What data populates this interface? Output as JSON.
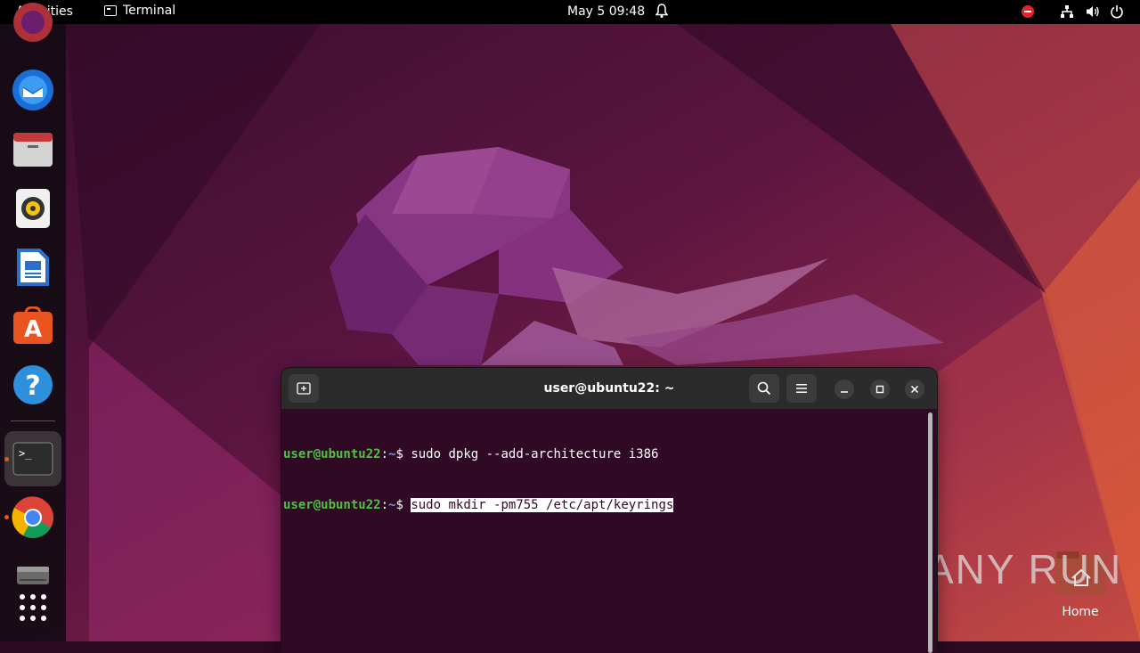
{
  "topbar": {
    "activities": "Activities",
    "app_name": "Terminal",
    "clock": "May 5  09:48"
  },
  "dock": {
    "items": [
      {
        "name": "firefox-icon"
      },
      {
        "name": "thunderbird-icon"
      },
      {
        "name": "files-icon"
      },
      {
        "name": "rhythmbox-icon"
      },
      {
        "name": "libreoffice-writer-icon"
      },
      {
        "name": "app-center-icon"
      },
      {
        "name": "help-icon"
      },
      {
        "name": "terminal-icon"
      },
      {
        "name": "chrome-icon"
      },
      {
        "name": "drive-icon"
      },
      {
        "name": "show-apps-icon"
      }
    ]
  },
  "terminal": {
    "title": "user@ubuntu22: ~",
    "lines": [
      {
        "user": "user@ubuntu22",
        "sep": ":",
        "path": "~",
        "prompt": "$ ",
        "command": "sudo dpkg --add-architecture i386"
      },
      {
        "user": "user@ubuntu22",
        "sep": ":",
        "path": "~",
        "prompt": "$ ",
        "command": "sudo mkdir -pm755 /etc/apt/keyrings"
      }
    ]
  },
  "desktop": {
    "home_label": "Home"
  },
  "watermark": "ANY RUN",
  "colors": {
    "accent": "#e95420",
    "terminal_bg": "#300a24",
    "prompt_user": "#4ec342",
    "prompt_path": "#6b9eea"
  }
}
